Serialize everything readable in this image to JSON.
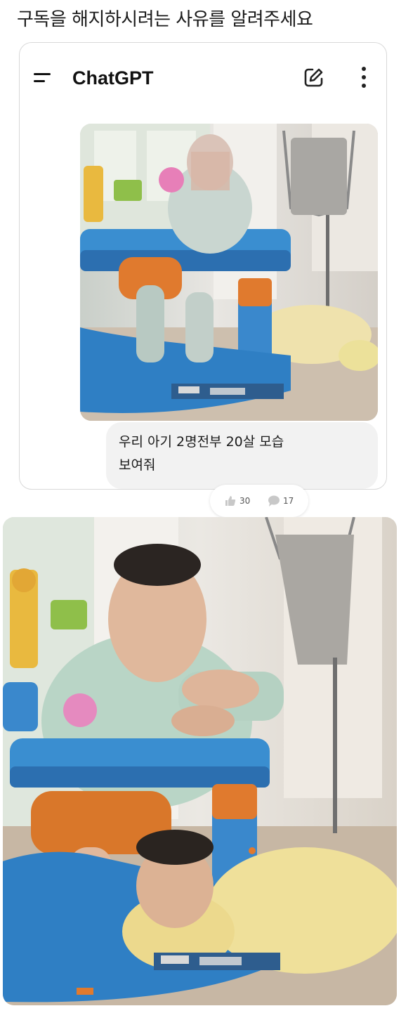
{
  "post": {
    "title": "구독을 해지하시려는 사유를 알려주세요"
  },
  "app": {
    "title": "ChatGPT",
    "icons": {
      "menu": "menu-icon",
      "edit": "edit-icon",
      "more": "more-vertical-icon"
    }
  },
  "chat": {
    "user_message_line1": "우리 아기 2명전부 20살 모습",
    "user_message_line2": "보여줘"
  },
  "reactions": {
    "likes": "30",
    "comments": "17"
  },
  "colors": {
    "walker_blue": "#3a8ed0",
    "walker_orange": "#e07a2e",
    "sweater_green": "#b8d4c4",
    "sweater_yellow": "#f0e09a"
  }
}
